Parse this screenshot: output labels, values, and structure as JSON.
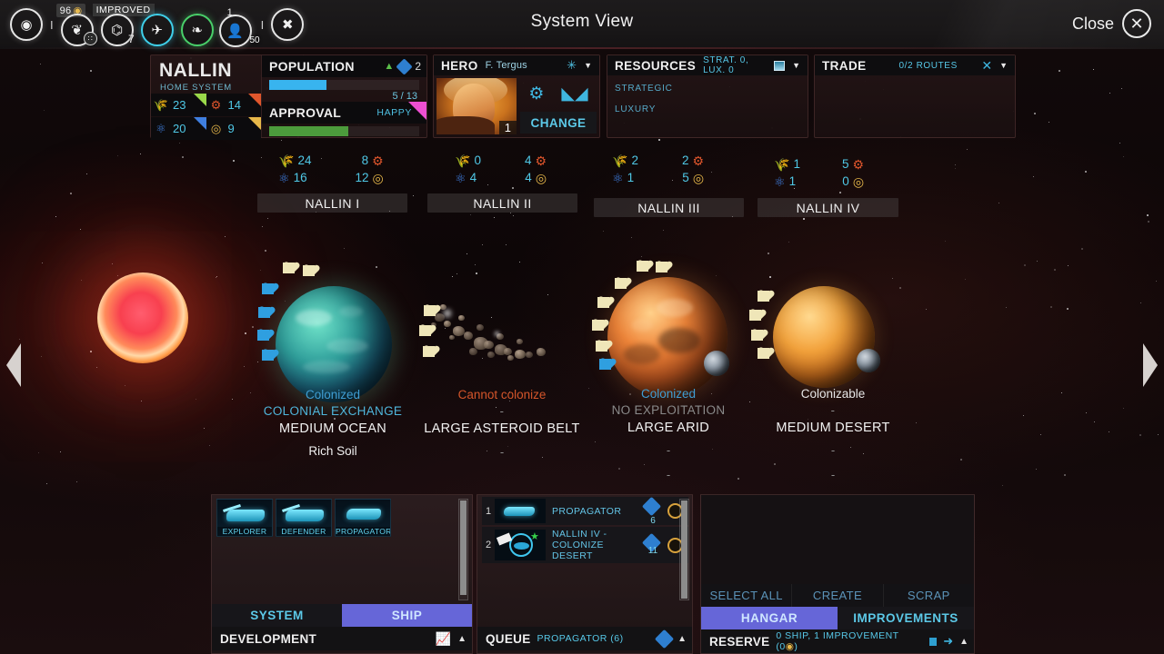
{
  "window": {
    "title": "System View",
    "close_label": "Close",
    "close_icon": "close-circle-icon"
  },
  "topbar": {
    "icons": [
      {
        "name": "empire-icon",
        "glyph": "◎"
      },
      {
        "name": "influence-icon",
        "glyph": "❦",
        "count": "96",
        "count_icon": "dust-coin-icon",
        "sub": "∷"
      },
      {
        "name": "science-icon",
        "glyph": "⌬",
        "tag": "IMPROVED",
        "sub": "7"
      },
      {
        "name": "military-icon",
        "glyph": "✈"
      },
      {
        "name": "diplomacy-icon",
        "glyph": "❧"
      },
      {
        "name": "population-icon",
        "glyph": "👤",
        "top": "1",
        "sub": "50"
      },
      {
        "name": "options-icon",
        "glyph": "✖"
      }
    ],
    "separator": "I"
  },
  "system": {
    "name": "NALLIN",
    "subtitle": "HOME SYSTEM",
    "fidsi": [
      {
        "name": "food",
        "icon": "wheat-icon",
        "value": "23",
        "color": "#9ad84a"
      },
      {
        "name": "industry",
        "icon": "gears-icon",
        "value": "14",
        "color": "#e0562c"
      },
      {
        "name": "science",
        "icon": "atom-icon",
        "value": "20",
        "color": "#3f7fe0"
      },
      {
        "name": "dust",
        "icon": "dust-icon",
        "value": "9",
        "color": "#e7b84a"
      }
    ],
    "population": {
      "label": "POPULATION",
      "trend": "▲",
      "badge": "2",
      "current": "5",
      "max": "13",
      "ratio_text": "5 / 13",
      "fill_pct": 38,
      "fill_color": "#38b4ef"
    },
    "approval": {
      "label": "APPROVAL",
      "status": "HAPPY",
      "fill_pct": 53,
      "fill_color": "#4c9b3c"
    }
  },
  "hero": {
    "label": "HERO",
    "name": "F. Tergus",
    "level": "1",
    "change_label": "CHANGE",
    "skill_icons": [
      "gear-leaf-icon",
      "mask-icon"
    ],
    "header_icon": "star-burst-icon"
  },
  "resources": {
    "label": "RESOURCES",
    "summary": "STRAT. 0, LUX. 0",
    "header_icon": "card-icon",
    "rows": [
      "STRATEGIC",
      "LUXURY"
    ]
  },
  "trade": {
    "label": "TRADE",
    "summary": "0/2 ROUTES",
    "header_icon": "trade-routes-icon"
  },
  "planets": [
    {
      "tab": "NALLIN I",
      "stats": [
        {
          "icon": "wheat-icon",
          "value": "24",
          "color": "#9ad84a"
        },
        {
          "icon": "atom-icon",
          "value": "16",
          "color": "#3f7fe0"
        },
        {
          "icon": "gears-icon",
          "value": "8",
          "color": "#e0562c"
        },
        {
          "icon": "dust-icon",
          "value": "12",
          "color": "#e7b84a"
        }
      ],
      "status": "Colonized",
      "status_color": "#3f9ed4",
      "subtitle": "COLONIAL EXCHANGE",
      "subtitle_color": "#4fb6dc",
      "type": "MEDIUM OCEAN",
      "anomaly": "Rich Soil",
      "extra": ""
    },
    {
      "tab": "NALLIN II",
      "stats": [
        {
          "icon": "wheat-icon",
          "value": "0",
          "color": "#9ad84a"
        },
        {
          "icon": "atom-icon",
          "value": "4",
          "color": "#3f7fe0"
        },
        {
          "icon": "gears-icon",
          "value": "4",
          "color": "#e0562c"
        },
        {
          "icon": "dust-icon",
          "value": "4",
          "color": "#e7b84a"
        }
      ],
      "status": "Cannot colonize",
      "status_color": "#d4552a",
      "subtitle": "-",
      "subtitle_color": "#8e8e8e",
      "type": "LARGE ASTEROID BELT",
      "anomaly": "-",
      "extra": ""
    },
    {
      "tab": "NALLIN III",
      "stats": [
        {
          "icon": "wheat-icon",
          "value": "2",
          "color": "#9ad84a"
        },
        {
          "icon": "atom-icon",
          "value": "1",
          "color": "#3f7fe0"
        },
        {
          "icon": "gears-icon",
          "value": "2",
          "color": "#e0562c"
        },
        {
          "icon": "dust-icon",
          "value": "5",
          "color": "#e7b84a"
        }
      ],
      "status": "Colonized",
      "status_color": "#3f9ed4",
      "subtitle": "NO EXPLOITATION",
      "subtitle_color": "#8a8a8a",
      "type": "LARGE ARID",
      "anomaly": "-",
      "extra": "-"
    },
    {
      "tab": "NALLIN IV",
      "stats": [
        {
          "icon": "wheat-icon",
          "value": "1",
          "color": "#9ad84a"
        },
        {
          "icon": "atom-icon",
          "value": "1",
          "color": "#3f7fe0"
        },
        {
          "icon": "gears-icon",
          "value": "5",
          "color": "#e0562c"
        },
        {
          "icon": "dust-icon",
          "value": "0",
          "color": "#e7b84a"
        }
      ],
      "status": "Colonizable",
      "status_color": "#e6e6e6",
      "subtitle": "-",
      "subtitle_color": "#8e8e8e",
      "type": "MEDIUM DESERT",
      "anomaly": "-",
      "extra": "-"
    }
  ],
  "build_panel": {
    "cards": [
      {
        "name": "EXPLORER"
      },
      {
        "name": "DEFENDER"
      },
      {
        "name": "PROPAGATOR"
      }
    ],
    "tabs": [
      {
        "label": "SYSTEM",
        "active": false
      },
      {
        "label": "SHIP",
        "active": true
      }
    ],
    "footer_title": "DEVELOPMENT",
    "footer_icon": "graph-icon",
    "footer_caret": "▲"
  },
  "queue_panel": {
    "rows": [
      {
        "index": "1",
        "name": "PROPAGATOR",
        "turns": "6",
        "thumb": "ship-icon"
      },
      {
        "index": "2",
        "name": "NALLIN IV - COLONIZE DESERT",
        "turns": "11",
        "thumb": "colonize-icon"
      }
    ],
    "footer_title": "QUEUE",
    "footer_sub": "PROPAGATOR (6)",
    "footer_caret": "▲"
  },
  "hangar_panel": {
    "actions": [
      "SELECT ALL",
      "CREATE",
      "SCRAP"
    ],
    "tabs": [
      {
        "label": "HANGAR",
        "active": true
      },
      {
        "label": "IMPROVEMENTS",
        "active": false
      }
    ],
    "footer_title": "RESERVE",
    "footer_sub": "0 SHIP, 1 IMPROVEMENT (0",
    "footer_sub_tail": ")",
    "footer_caret": "▲"
  },
  "navigation": {
    "left": "prev-system-arrow",
    "right": "next-system-arrow"
  },
  "colors": {
    "accent_cyan": "#5cc9e8",
    "accent_purple": "#6666d8",
    "food": "#9ad84a",
    "industry": "#e0562c",
    "science": "#3f7fe0",
    "dust": "#e7b84a",
    "colonized": "#3f9ed4",
    "cannot": "#d4552a"
  }
}
